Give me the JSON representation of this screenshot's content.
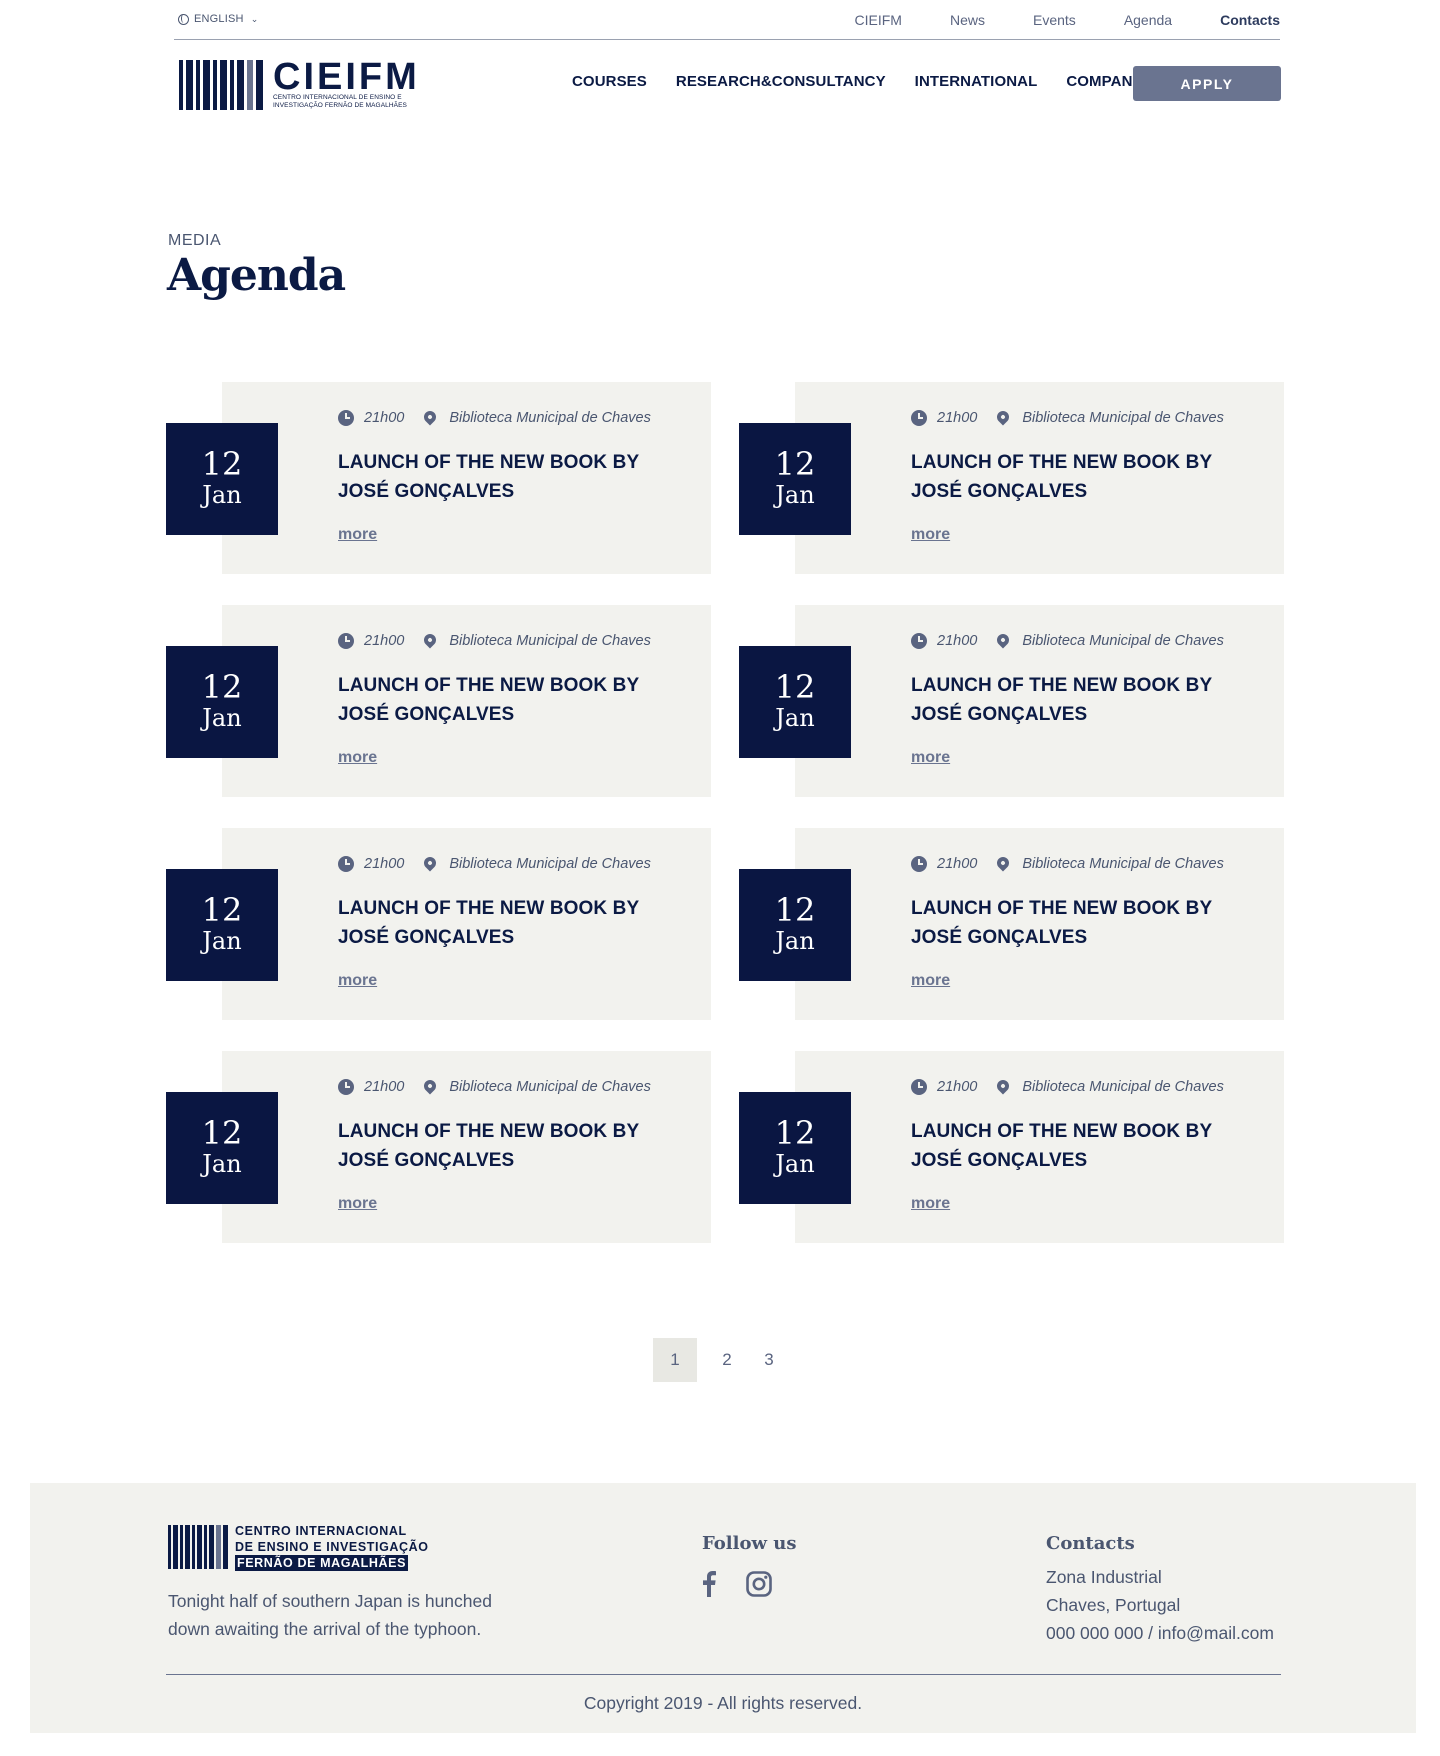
{
  "topbar": {
    "language": "ENGLISH",
    "links": [
      "CIEIFM",
      "News",
      "Events",
      "Agenda",
      "Contacts"
    ],
    "active": "Contacts"
  },
  "header": {
    "logo_title": "CIEIFM",
    "logo_subtitle_1": "CENTRO INTERNACIONAL DE ENSINO E",
    "logo_subtitle_2": "INVESTIGAÇÃO FERNÃO DE MAGALHÃES",
    "nav": [
      "COURSES",
      "RESEARCH&CONSULTANCY",
      "INTERNATIONAL",
      "COMPANIES"
    ],
    "apply_label": "APPLY"
  },
  "page": {
    "eyebrow": "MEDIA",
    "title": "Agenda"
  },
  "events": [
    {
      "day": "12",
      "month": "Jan",
      "time": "21h00",
      "location": "Biblioteca Municipal de Chaves",
      "title": "LAUNCH OF THE NEW BOOK BY JOSÉ GONÇALVES",
      "more": "more"
    },
    {
      "day": "12",
      "month": "Jan",
      "time": "21h00",
      "location": "Biblioteca Municipal de Chaves",
      "title": "LAUNCH OF THE NEW BOOK BY JOSÉ GONÇALVES",
      "more": "more"
    },
    {
      "day": "12",
      "month": "Jan",
      "time": "21h00",
      "location": "Biblioteca Municipal de Chaves",
      "title": "LAUNCH OF THE NEW BOOK BY JOSÉ GONÇALVES",
      "more": "more"
    },
    {
      "day": "12",
      "month": "Jan",
      "time": "21h00",
      "location": "Biblioteca Municipal de Chaves",
      "title": "LAUNCH OF THE NEW BOOK BY JOSÉ GONÇALVES",
      "more": "more"
    },
    {
      "day": "12",
      "month": "Jan",
      "time": "21h00",
      "location": "Biblioteca Municipal de Chaves",
      "title": "LAUNCH OF THE NEW BOOK BY JOSÉ GONÇALVES",
      "more": "more"
    },
    {
      "day": "12",
      "month": "Jan",
      "time": "21h00",
      "location": "Biblioteca Municipal de Chaves",
      "title": "LAUNCH OF THE NEW BOOK BY JOSÉ GONÇALVES",
      "more": "more"
    },
    {
      "day": "12",
      "month": "Jan",
      "time": "21h00",
      "location": "Biblioteca Municipal de Chaves",
      "title": "LAUNCH OF THE NEW BOOK BY JOSÉ GONÇALVES",
      "more": "more"
    },
    {
      "day": "12",
      "month": "Jan",
      "time": "21h00",
      "location": "Biblioteca Municipal de Chaves",
      "title": "LAUNCH OF THE NEW BOOK BY JOSÉ GONÇALVES",
      "more": "more"
    }
  ],
  "pagination": {
    "current": "1",
    "pages": [
      "2",
      "3"
    ]
  },
  "footer": {
    "logo_line_1": "CENTRO INTERNACIONAL",
    "logo_line_2": "DE ENSINO E INVESTIGAÇÃO",
    "logo_line_3": "FERNÃO DE MAGALHÃES",
    "tagline": "Tonight half of southern Japan is hunched down awaiting the arrival of the typhoon.",
    "follow_title": "Follow us",
    "social_icons": [
      "facebook-icon",
      "instagram-icon"
    ],
    "contacts_title": "Contacts",
    "address_1": "Zona Industrial",
    "address_2": "Chaves, Portugal",
    "phone_email": "000 000 000 / info@mail.com",
    "copyright": "Copyright 2019 - All rights reserved."
  },
  "colors": {
    "navy": "#0a1642",
    "slate": "#6a7490",
    "panel": "#f2f2ee"
  }
}
